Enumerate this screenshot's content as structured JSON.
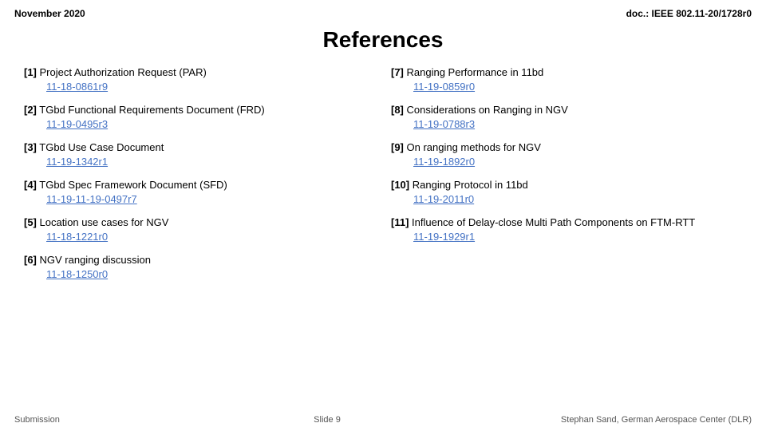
{
  "header": {
    "left": "November 2020",
    "right": "doc.: IEEE 802.11-20/1728r0"
  },
  "title": "References",
  "references": {
    "left": [
      {
        "id": "[1]",
        "label": "Project Authorization Request (PAR)",
        "link": "11-18-0861r9"
      },
      {
        "id": "[2]",
        "label": "TGbd Functional Requirements Document (FRD)",
        "link": "11-19-0495r3"
      },
      {
        "id": "[3]",
        "label": "TGbd Use Case Document",
        "link": "11-19-1342r1"
      },
      {
        "id": "[4]",
        "label": "TGbd Spec Framework Document (SFD)",
        "link": "11-19-11-19-0497r7"
      },
      {
        "id": "[5]",
        "label": "Location use cases for NGV",
        "link": "11-18-1221r0"
      },
      {
        "id": "[6]",
        "label": "NGV ranging discussion",
        "link": "11-18-1250r0"
      }
    ],
    "right": [
      {
        "id": "[7]",
        "label": "Ranging Performance in 11bd",
        "link": "11-19-0859r0"
      },
      {
        "id": "[8]",
        "label": "Considerations on Ranging in NGV",
        "link": "11-19-0788r3"
      },
      {
        "id": "[9]",
        "label": "On ranging methods for NGV",
        "link": "11-19-1892r0"
      },
      {
        "id": "[10]",
        "label": "Ranging Protocol in 11bd",
        "link": "11-19-2011r0"
      },
      {
        "id": "[11]",
        "label": "Influence of Delay-close Multi Path Components on FTM-RTT",
        "link": "11-19-1929r1"
      }
    ]
  },
  "footer": {
    "left": "Submission",
    "center": "Slide 9",
    "right": "Stephan Sand, German Aerospace Center (DLR)"
  }
}
